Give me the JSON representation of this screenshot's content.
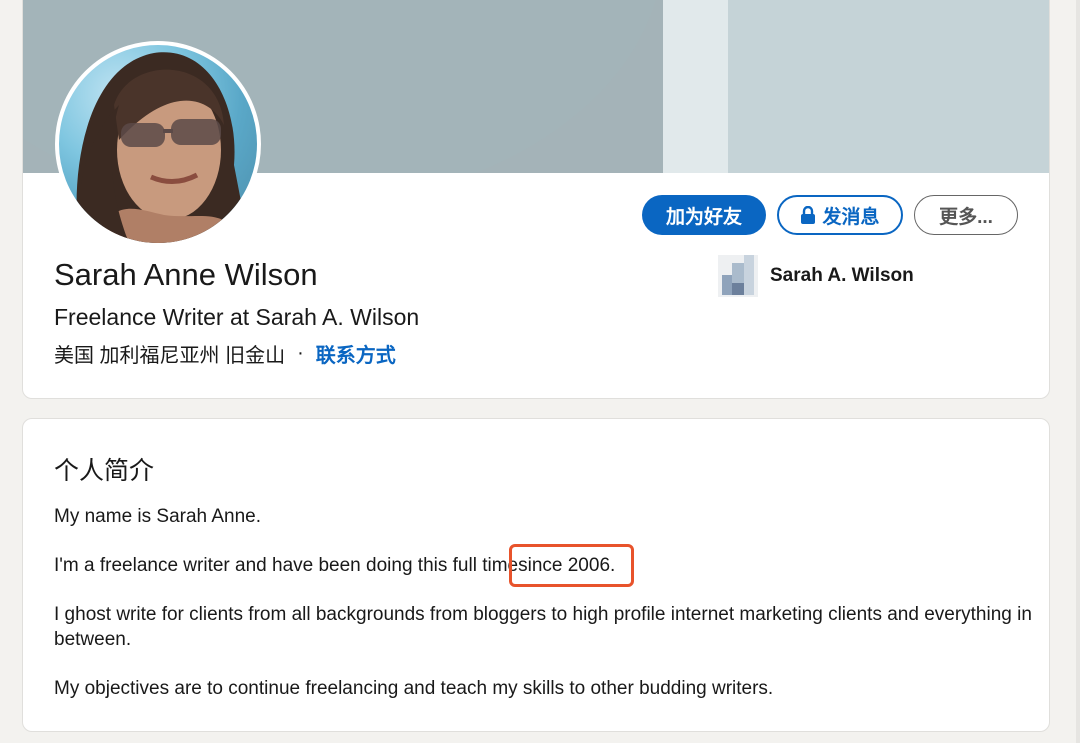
{
  "profile": {
    "name": "Sarah Anne Wilson",
    "headline": "Freelance Writer at Sarah A. Wilson",
    "location": "美国 加利福尼亚州 旧金山",
    "separator": "·",
    "contact_link": "联系方式",
    "company": "Sarah A. Wilson",
    "buttons": {
      "connect": "加为好友",
      "message": "发消息",
      "more": "更多..."
    }
  },
  "about": {
    "title": "个人简介",
    "paragraphs": [
      "My name is Sarah Anne.",
      "I'm a freelance writer and have been doing this full time",
      "I ghost write for clients from all backgrounds from bloggers to high profile internet marketing clients and everything in between.",
      "My objectives are to continue freelancing and teach my skills to other budding writers."
    ],
    "highlighted": "since 2006."
  },
  "colors": {
    "accent": "#0a66c2",
    "highlight_box": "#e8532b",
    "background": "#f3f2ef"
  },
  "icons": {
    "message_button": "lock-icon"
  }
}
